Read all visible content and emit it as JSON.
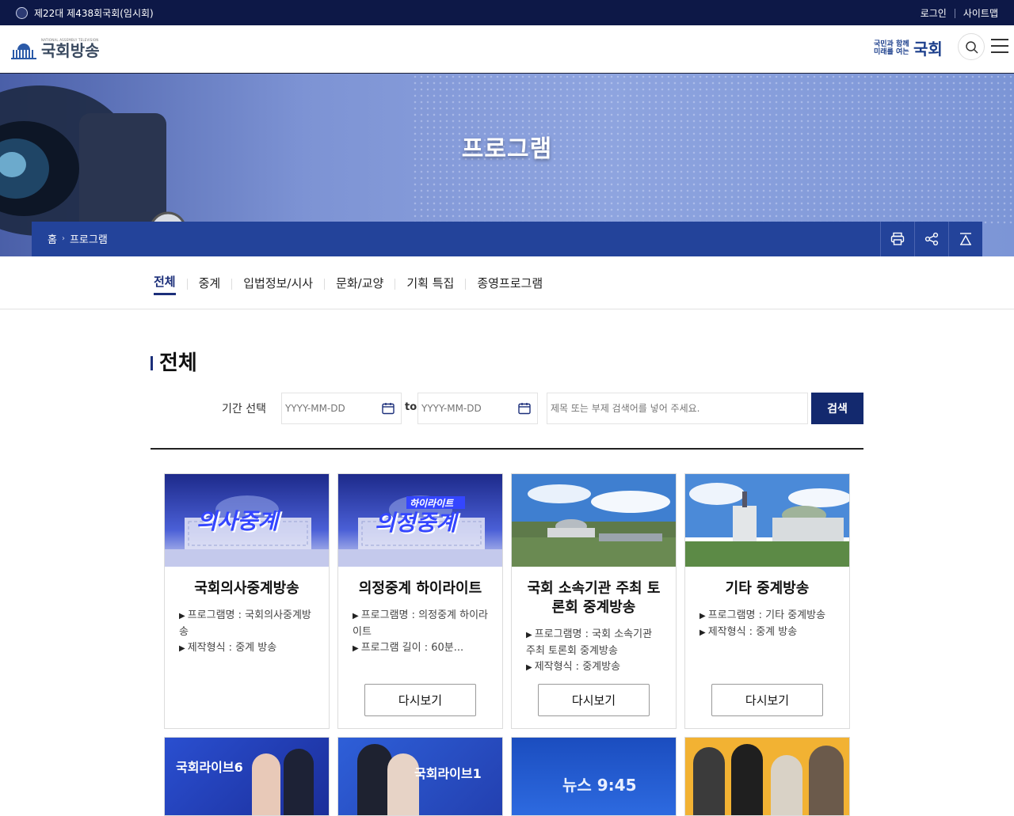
{
  "topbar": {
    "session": "제22대 제438회국회(임시회)",
    "login": "로그인",
    "sitemap": "사이트맵"
  },
  "header": {
    "logo_sub": "NATIONAL ASSEMBLY TELEVISION",
    "logo_text": "국회방송",
    "slogan_small": "국민과 함께 미래를 여는",
    "slogan_big": "국회"
  },
  "hero": {
    "title": "프로그램",
    "breadcrumb": [
      "홈",
      "프로그램"
    ]
  },
  "tabs": [
    {
      "label": "전체",
      "active": true
    },
    {
      "label": "중계",
      "active": false
    },
    {
      "label": "입법정보/시사",
      "active": false
    },
    {
      "label": "문화/교양",
      "active": false
    },
    {
      "label": "기획 특집",
      "active": false
    },
    {
      "label": "종영프로그램",
      "active": false
    }
  ],
  "section": {
    "title": "전체",
    "period_label": "기간 선택",
    "date_placeholder": "YYYY-MM-DD",
    "to": "to",
    "keyword_placeholder": "제목 또는 부제 검색어를 넣어 주세요.",
    "search_button": "검색"
  },
  "cards": [
    {
      "title": "국회의사중계방송",
      "details": [
        "프로그램명 : 국회의사중계방송",
        "제작형식 : 중계 방송"
      ],
      "button": null,
      "thumb_text": "의사중계",
      "thumb_sub": ""
    },
    {
      "title": "의정중계 하이라이트",
      "details": [
        "프로그램명 : 의정중계 하이라이트",
        "프로그램 길이 : 60분..."
      ],
      "button": "다시보기",
      "thumb_text": "의정중계",
      "thumb_sub": "하이라이트"
    },
    {
      "title": "국회 소속기관 주최 토론회 중계방송",
      "details": [
        "프로그램명 : 국회 소속기관 주최 토론회 중계방송",
        "제작형식 : 중계방송"
      ],
      "button": "다시보기"
    },
    {
      "title": "기타 중계방송",
      "details": [
        "프로그램명 : 기타 중계방송",
        "제작형식 : 중계 방송"
      ],
      "button": "다시보기"
    }
  ],
  "cards_row2": [
    {
      "thumb_text": "국회라이브6"
    },
    {
      "thumb_text": "국회라이브1"
    },
    {
      "thumb_text": "뉴스 9:45"
    },
    {
      "thumb_text": ""
    }
  ],
  "colors": {
    "topbar": "#0d1847",
    "accent": "#1c2f7a",
    "crumbbar": "#23439a",
    "search_button": "#13296e"
  }
}
